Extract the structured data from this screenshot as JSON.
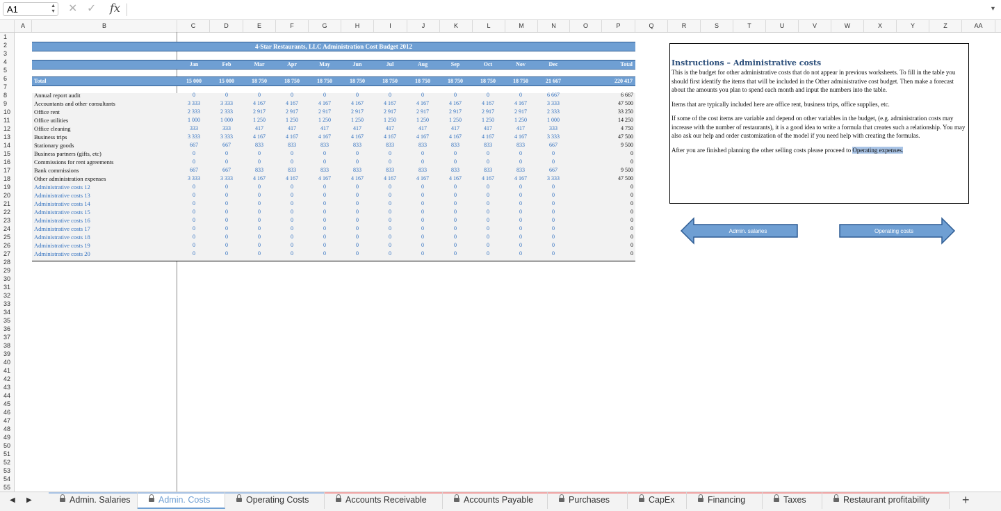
{
  "formula_bar": {
    "cell_ref": "A1",
    "fx_label": "fx",
    "formula": ""
  },
  "columns": [
    "A",
    "B",
    "C",
    "D",
    "E",
    "F",
    "G",
    "H",
    "I",
    "J",
    "K",
    "L",
    "M",
    "N",
    "O",
    "P",
    "Q",
    "R",
    "S",
    "T",
    "U",
    "V",
    "W",
    "X",
    "Y",
    "Z",
    "AA"
  ],
  "row_numbers": [
    "1",
    "2",
    "3",
    "4",
    "5",
    "6",
    "7",
    "8",
    "9",
    "10",
    "11",
    "12",
    "13",
    "14",
    "15",
    "16",
    "17",
    "18",
    "19",
    "20",
    "21",
    "22",
    "23",
    "24",
    "25",
    "26",
    "27",
    "28",
    "29",
    "30",
    "31",
    "32",
    "33",
    "34",
    "35",
    "36",
    "37",
    "38",
    "39",
    "40",
    "41",
    "42",
    "43",
    "44",
    "45",
    "46",
    "47",
    "48",
    "49",
    "50",
    "51",
    "52",
    "53",
    "54",
    "55"
  ],
  "budget": {
    "title": "4-Star Restaurants, LLC Administration Cost Budget 2012",
    "months": [
      "Jan",
      "Feb",
      "Mar",
      "Apr",
      "May",
      "Jun",
      "Jul",
      "Aug",
      "Sep",
      "Oct",
      "Nov",
      "Dec"
    ],
    "total_header": "Total",
    "total_label": "Total",
    "totals": [
      "15 000",
      "15 000",
      "18 750",
      "18 750",
      "18 750",
      "18 750",
      "18 750",
      "18 750",
      "18 750",
      "18 750",
      "18 750",
      "21 667"
    ],
    "grand_total": "220 417",
    "rows": [
      {
        "label": "Annual report audit",
        "blue": false,
        "values": [
          "0",
          "0",
          "0",
          "0",
          "0",
          "0",
          "0",
          "0",
          "0",
          "0",
          "0",
          "6 667"
        ],
        "total": "6 667"
      },
      {
        "label": "Accountants and other consultants",
        "blue": false,
        "values": [
          "3 333",
          "3 333",
          "4 167",
          "4 167",
          "4 167",
          "4 167",
          "4 167",
          "4 167",
          "4 167",
          "4 167",
          "4 167",
          "3 333"
        ],
        "total": "47 500"
      },
      {
        "label": "Office rent",
        "blue": false,
        "values": [
          "2 333",
          "2 333",
          "2 917",
          "2 917",
          "2 917",
          "2 917",
          "2 917",
          "2 917",
          "2 917",
          "2 917",
          "2 917",
          "2 333"
        ],
        "total": "33 250"
      },
      {
        "label": "Office utilities",
        "blue": false,
        "values": [
          "1 000",
          "1 000",
          "1 250",
          "1 250",
          "1 250",
          "1 250",
          "1 250",
          "1 250",
          "1 250",
          "1 250",
          "1 250",
          "1 000"
        ],
        "total": "14 250"
      },
      {
        "label": "Office cleaning",
        "blue": false,
        "values": [
          "333",
          "333",
          "417",
          "417",
          "417",
          "417",
          "417",
          "417",
          "417",
          "417",
          "417",
          "333"
        ],
        "total": "4 750"
      },
      {
        "label": "Business trips",
        "blue": false,
        "values": [
          "3 333",
          "3 333",
          "4 167",
          "4 167",
          "4 167",
          "4 167",
          "4 167",
          "4 167",
          "4 167",
          "4 167",
          "4 167",
          "3 333"
        ],
        "total": "47 500"
      },
      {
        "label": "Stationary goods",
        "blue": false,
        "values": [
          "667",
          "667",
          "833",
          "833",
          "833",
          "833",
          "833",
          "833",
          "833",
          "833",
          "833",
          "667"
        ],
        "total": "9 500"
      },
      {
        "label": "Business partners (gifts, etc)",
        "blue": false,
        "values": [
          "0",
          "0",
          "0",
          "0",
          "0",
          "0",
          "0",
          "0",
          "0",
          "0",
          "0",
          "0"
        ],
        "total": "0"
      },
      {
        "label": "Commissions for rent agreements",
        "blue": false,
        "values": [
          "0",
          "0",
          "0",
          "0",
          "0",
          "0",
          "0",
          "0",
          "0",
          "0",
          "0",
          "0"
        ],
        "total": "0"
      },
      {
        "label": "Bank commissions",
        "blue": false,
        "values": [
          "667",
          "667",
          "833",
          "833",
          "833",
          "833",
          "833",
          "833",
          "833",
          "833",
          "833",
          "667"
        ],
        "total": "9 500"
      },
      {
        "label": "Other administration expenses",
        "blue": false,
        "values": [
          "3 333",
          "3 333",
          "4 167",
          "4 167",
          "4 167",
          "4 167",
          "4 167",
          "4 167",
          "4 167",
          "4 167",
          "4 167",
          "3 333"
        ],
        "total": "47 500"
      },
      {
        "label": "Administrative costs 12",
        "blue": true,
        "values": [
          "0",
          "0",
          "0",
          "0",
          "0",
          "0",
          "0",
          "0",
          "0",
          "0",
          "0",
          "0"
        ],
        "total": "0"
      },
      {
        "label": "Administrative costs 13",
        "blue": true,
        "values": [
          "0",
          "0",
          "0",
          "0",
          "0",
          "0",
          "0",
          "0",
          "0",
          "0",
          "0",
          "0"
        ],
        "total": "0"
      },
      {
        "label": "Administrative costs 14",
        "blue": true,
        "values": [
          "0",
          "0",
          "0",
          "0",
          "0",
          "0",
          "0",
          "0",
          "0",
          "0",
          "0",
          "0"
        ],
        "total": "0"
      },
      {
        "label": "Administrative costs 15",
        "blue": true,
        "values": [
          "0",
          "0",
          "0",
          "0",
          "0",
          "0",
          "0",
          "0",
          "0",
          "0",
          "0",
          "0"
        ],
        "total": "0"
      },
      {
        "label": "Administrative costs 16",
        "blue": true,
        "values": [
          "0",
          "0",
          "0",
          "0",
          "0",
          "0",
          "0",
          "0",
          "0",
          "0",
          "0",
          "0"
        ],
        "total": "0"
      },
      {
        "label": "Administrative costs 17",
        "blue": true,
        "values": [
          "0",
          "0",
          "0",
          "0",
          "0",
          "0",
          "0",
          "0",
          "0",
          "0",
          "0",
          "0"
        ],
        "total": "0"
      },
      {
        "label": "Administrative costs 18",
        "blue": true,
        "values": [
          "0",
          "0",
          "0",
          "0",
          "0",
          "0",
          "0",
          "0",
          "0",
          "0",
          "0",
          "0"
        ],
        "total": "0"
      },
      {
        "label": "Administrative costs 19",
        "blue": true,
        "values": [
          "0",
          "0",
          "0",
          "0",
          "0",
          "0",
          "0",
          "0",
          "0",
          "0",
          "0",
          "0"
        ],
        "total": "0"
      },
      {
        "label": "Administrative costs 20",
        "blue": true,
        "values": [
          "0",
          "0",
          "0",
          "0",
          "0",
          "0",
          "0",
          "0",
          "0",
          "0",
          "0",
          "0"
        ],
        "total": "0"
      }
    ]
  },
  "instructions": {
    "title": "Instructions – Administrative costs",
    "p1": "This is the budget for other administrative costs that do not appear in previous worksheets. To fill in the table you should first identify the items that will be included in the Other administrative cost budget. Then make a forecast about the amounts you plan to spend each month and input the numbers into the table.",
    "p2": "Items that are typically included here are office rent, business trips, office supplies, etc.",
    "p3": "If some of the cost items are variable and depend on other variables in the budget, (e.g. administration costs may increase with the number of restaurants), it is a good idea to write a formula that creates such a relationship. You may also ask our help and order customization of the model if you need help with creating the formulas.",
    "p4_before": "After you are finished planning the other selling costs please proceed to ",
    "p4_link": "Operating expenses."
  },
  "nav_buttons": {
    "back": "Admin. salaries",
    "next": "Operating costs"
  },
  "sheet_tabs": [
    {
      "label": "Admin. Salaries",
      "active": false,
      "color": "#a9c4e6"
    },
    {
      "label": "Admin. Costs",
      "active": true,
      "color": "#a9c4e6"
    },
    {
      "label": "Operating Costs",
      "active": false,
      "color": "#a9c4e6"
    },
    {
      "label": "Accounts Receivable",
      "active": false,
      "color": "#f2a6a6"
    },
    {
      "label": "Accounts Payable",
      "active": false,
      "color": "#f2a6a6"
    },
    {
      "label": "Purchases",
      "active": false,
      "color": "#f2a6a6"
    },
    {
      "label": "CapEx",
      "active": false,
      "color": "#f2a6a6"
    },
    {
      "label": "Financing",
      "active": false,
      "color": "#f2a6a6"
    },
    {
      "label": "Taxes",
      "active": false,
      "color": "#f2a6a6"
    },
    {
      "label": "Restaurant profitability",
      "active": false,
      "color": "#f2a6a6"
    }
  ],
  "add_sheet": "+"
}
